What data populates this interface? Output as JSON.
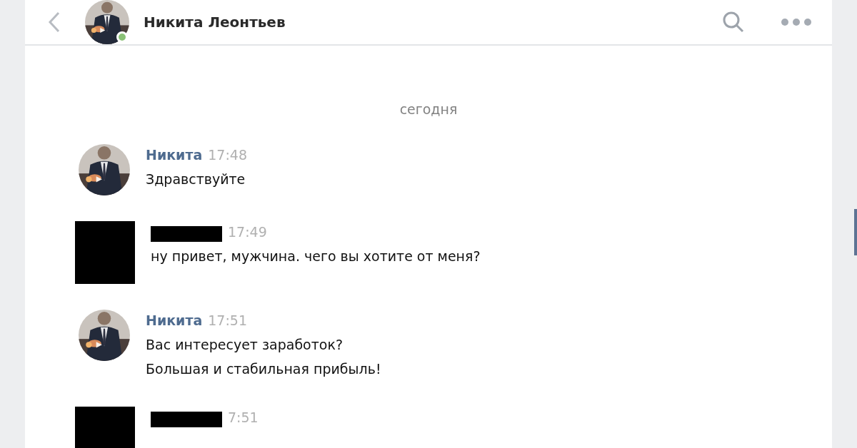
{
  "header": {
    "title": "Никита Леонтьев",
    "online": true
  },
  "date_separator": "сегодня",
  "messages": [
    {
      "kind": "contact",
      "name": "Никита",
      "time": "17:48",
      "lines": [
        "Здравствуйте"
      ]
    },
    {
      "kind": "redacted",
      "time": "17:49",
      "lines": [
        "ну привет, мужчина. чего вы хотите от меня?"
      ]
    },
    {
      "kind": "contact",
      "name": "Никита",
      "time": "17:51",
      "lines": [
        "Вас интересует заработок?",
        "Большая и стабильная прибыль!"
      ]
    },
    {
      "kind": "redacted",
      "time": "7:51"
    }
  ]
}
